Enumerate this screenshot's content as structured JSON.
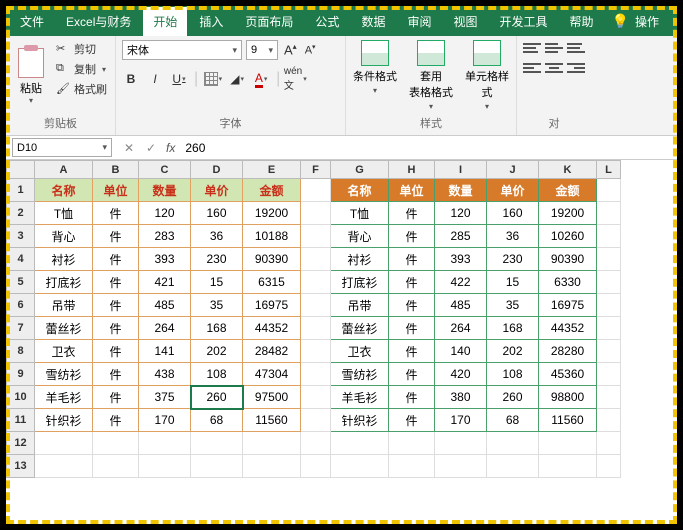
{
  "tabs": {
    "file": "文件",
    "excel_finance": "Excel与财务",
    "home": "开始",
    "insert": "插入",
    "page_layout": "页面布局",
    "formulas": "公式",
    "data": "数据",
    "review": "审阅",
    "view": "视图",
    "devtools": "开发工具",
    "help": "帮助",
    "tell_me": "操作"
  },
  "ribbon": {
    "clipboard": {
      "label": "剪贴板",
      "paste": "粘贴",
      "cut": "剪切",
      "copy": "复制",
      "format_painter": "格式刷"
    },
    "font": {
      "label": "字体",
      "name": "宋体",
      "size": "9",
      "bold": "B",
      "italic": "I",
      "underline": "U"
    },
    "styles": {
      "label": "样式",
      "cond_format": "条件格式",
      "table_format": "套用\n表格格式",
      "cell_styles": "单元格样式"
    },
    "align": {
      "label": "对"
    }
  },
  "formula_bar": {
    "name_box": "D10",
    "value": "260"
  },
  "columns": [
    "A",
    "B",
    "C",
    "D",
    "E",
    "F",
    "G",
    "H",
    "I",
    "J",
    "K",
    "L"
  ],
  "headers": {
    "name": "名称",
    "unit": "单位",
    "qty": "数量",
    "price": "单价",
    "amount": "金额"
  },
  "left_rows": [
    {
      "name": "T恤",
      "unit": "件",
      "qty": "120",
      "price": "160",
      "amount": "19200"
    },
    {
      "name": "背心",
      "unit": "件",
      "qty": "283",
      "price": "36",
      "amount": "10188"
    },
    {
      "name": "衬衫",
      "unit": "件",
      "qty": "393",
      "price": "230",
      "amount": "90390"
    },
    {
      "name": "打底衫",
      "unit": "件",
      "qty": "421",
      "price": "15",
      "amount": "6315"
    },
    {
      "name": "吊带",
      "unit": "件",
      "qty": "485",
      "price": "35",
      "amount": "16975"
    },
    {
      "name": "蕾丝衫",
      "unit": "件",
      "qty": "264",
      "price": "168",
      "amount": "44352"
    },
    {
      "name": "卫衣",
      "unit": "件",
      "qty": "141",
      "price": "202",
      "amount": "28482"
    },
    {
      "name": "雪纺衫",
      "unit": "件",
      "qty": "438",
      "price": "108",
      "amount": "47304"
    },
    {
      "name": "羊毛衫",
      "unit": "件",
      "qty": "375",
      "price": "260",
      "amount": "97500"
    },
    {
      "name": "针织衫",
      "unit": "件",
      "qty": "170",
      "price": "68",
      "amount": "11560"
    }
  ],
  "right_rows": [
    {
      "name": "T恤",
      "unit": "件",
      "qty": "120",
      "price": "160",
      "amount": "19200"
    },
    {
      "name": "背心",
      "unit": "件",
      "qty": "285",
      "price": "36",
      "amount": "10260"
    },
    {
      "name": "衬衫",
      "unit": "件",
      "qty": "393",
      "price": "230",
      "amount": "90390"
    },
    {
      "name": "打底衫",
      "unit": "件",
      "qty": "422",
      "price": "15",
      "amount": "6330"
    },
    {
      "name": "吊带",
      "unit": "件",
      "qty": "485",
      "price": "35",
      "amount": "16975"
    },
    {
      "name": "蕾丝衫",
      "unit": "件",
      "qty": "264",
      "price": "168",
      "amount": "44352"
    },
    {
      "name": "卫衣",
      "unit": "件",
      "qty": "140",
      "price": "202",
      "amount": "28280"
    },
    {
      "name": "雪纺衫",
      "unit": "件",
      "qty": "420",
      "price": "108",
      "amount": "45360"
    },
    {
      "name": "羊毛衫",
      "unit": "件",
      "qty": "380",
      "price": "260",
      "amount": "98800"
    },
    {
      "name": "针织衫",
      "unit": "件",
      "qty": "170",
      "price": "68",
      "amount": "11560"
    }
  ],
  "chart_data": {
    "type": "table",
    "title": "",
    "tables": [
      {
        "columns": [
          "名称",
          "单位",
          "数量",
          "单价",
          "金额"
        ],
        "rows": [
          [
            "T恤",
            "件",
            120,
            160,
            19200
          ],
          [
            "背心",
            "件",
            283,
            36,
            10188
          ],
          [
            "衬衫",
            "件",
            393,
            230,
            90390
          ],
          [
            "打底衫",
            "件",
            421,
            15,
            6315
          ],
          [
            "吊带",
            "件",
            485,
            35,
            16975
          ],
          [
            "蕾丝衫",
            "件",
            264,
            168,
            44352
          ],
          [
            "卫衣",
            "件",
            141,
            202,
            28482
          ],
          [
            "雪纺衫",
            "件",
            438,
            108,
            47304
          ],
          [
            "羊毛衫",
            "件",
            375,
            260,
            97500
          ],
          [
            "针织衫",
            "件",
            170,
            68,
            11560
          ]
        ]
      },
      {
        "columns": [
          "名称",
          "单位",
          "数量",
          "单价",
          "金额"
        ],
        "rows": [
          [
            "T恤",
            "件",
            120,
            160,
            19200
          ],
          [
            "背心",
            "件",
            285,
            36,
            10260
          ],
          [
            "衬衫",
            "件",
            393,
            230,
            90390
          ],
          [
            "打底衫",
            "件",
            422,
            15,
            6330
          ],
          [
            "吊带",
            "件",
            485,
            35,
            16975
          ],
          [
            "蕾丝衫",
            "件",
            264,
            168,
            44352
          ],
          [
            "卫衣",
            "件",
            140,
            202,
            28280
          ],
          [
            "雪纺衫",
            "件",
            420,
            108,
            45360
          ],
          [
            "羊毛衫",
            "件",
            380,
            260,
            98800
          ],
          [
            "针织衫",
            "件",
            170,
            68,
            11560
          ]
        ]
      }
    ]
  }
}
